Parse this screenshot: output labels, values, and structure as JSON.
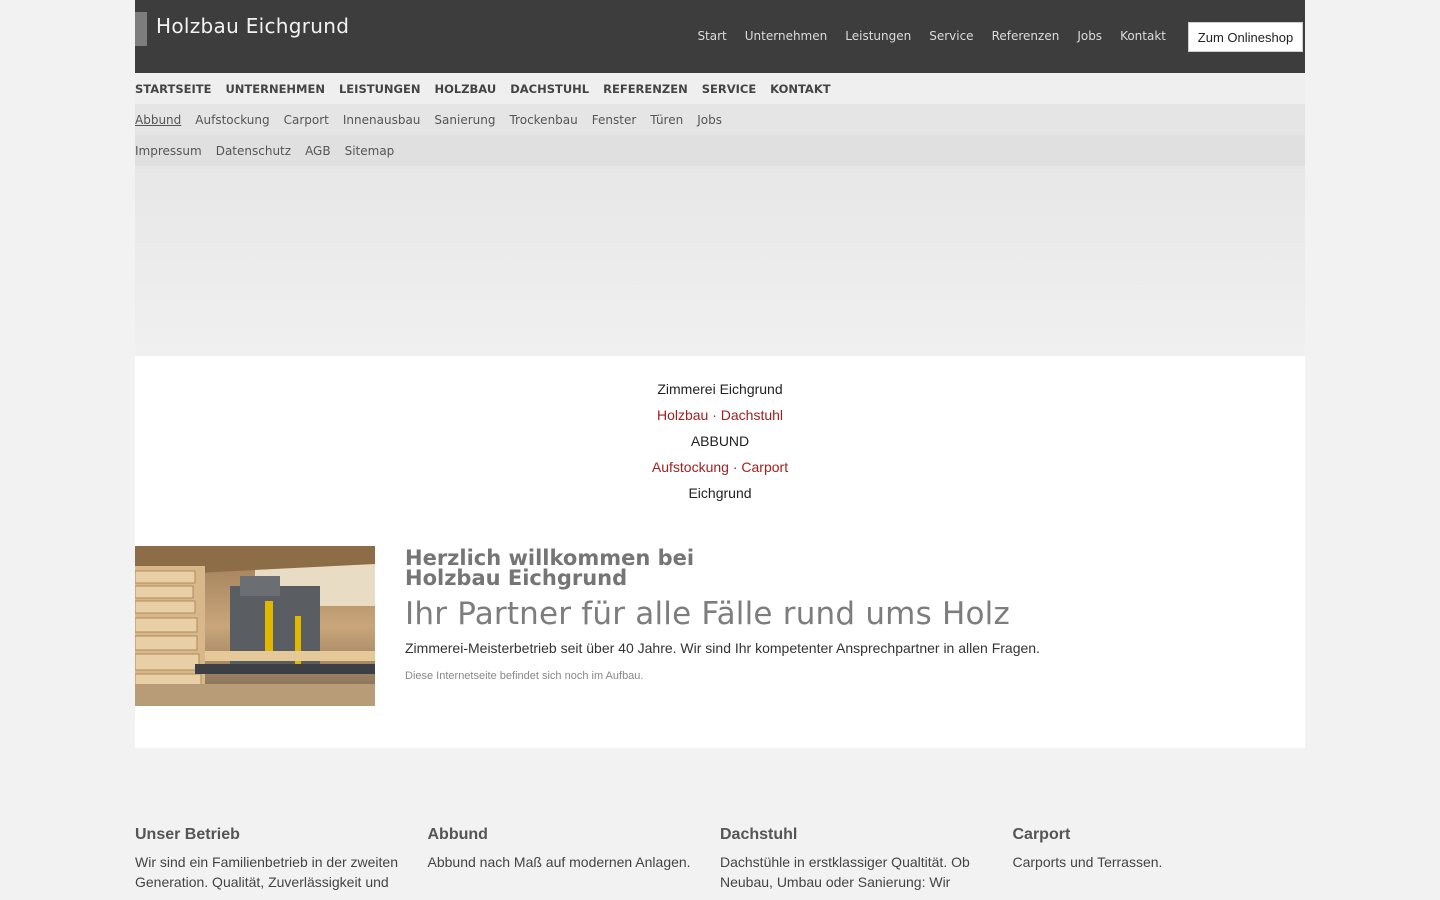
{
  "brand": {
    "name": "Holzbau Eichgrund"
  },
  "top_nav": [
    "Start",
    "Unternehmen",
    "Leistungen",
    "Service",
    "Referenzen",
    "Jobs",
    "Kontakt"
  ],
  "shop_button": "Zum Onlineshop",
  "main_nav": [
    "STARTSEITE",
    "UNTERNEHMEN",
    "LEISTUNGEN",
    "HOLZBAU",
    "DACHSTUHL",
    "REFERENZEN",
    "SERVICE",
    "KONTAKT"
  ],
  "sub_nav": {
    "active": "Abbund",
    "items": [
      "Abbund",
      "Aufstockung",
      "Carport",
      "Innenausbau",
      "Sanierung",
      "Trockenbau",
      "Fenster",
      "Türen",
      "Jobs"
    ]
  },
  "footer_nav": [
    "Impressum",
    "Datenschutz",
    "AGB",
    "Sitemap"
  ],
  "tagline": {
    "line1": "Zimmerei Eichgrund",
    "line2a": "Holzbau",
    "line2b": "Dachstuhl",
    "line3": "ABBUND",
    "line4a": "Aufstockung",
    "line4b": "Carport",
    "line5": "Eichgrund",
    "separator": "·"
  },
  "intro": {
    "welcome_line1": "Herzlich willkommen bei",
    "welcome_line2": "Holzbau Eichgrund",
    "headline": "Ihr Partner für alle Fälle rund ums Holz",
    "lead": "Zimmerei-Meisterbetrieb seit über 40 Jahre. Wir sind Ihr kompetenter Ansprechpartner in allen Fragen.",
    "note": "Diese Internetseite befindet sich noch im Aufbau."
  },
  "features": [
    {
      "title": "Unser Betrieb",
      "text": "Wir sind ein Familienbetrieb in der zweiten Generation. Qualität, Zuverlässigkeit und"
    },
    {
      "title": "Abbund",
      "text": "Abbund nach Maß auf modernen Anlagen."
    },
    {
      "title": "Dachstuhl",
      "text": "Dachstühle in erstklassiger Qualtität. Ob Neubau, Umbau oder Sanierung: Wir"
    },
    {
      "title": "Carport",
      "text": "Carports und Terrassen."
    }
  ],
  "colors": {
    "header_bg": "#3d3d3d",
    "accent_red": "#a32020"
  }
}
